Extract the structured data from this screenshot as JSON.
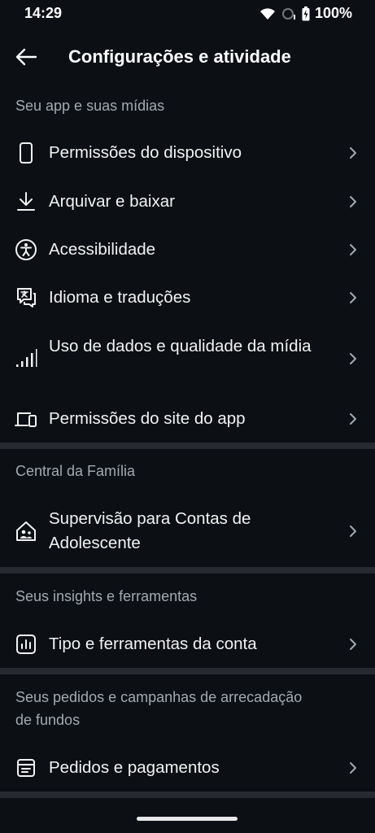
{
  "status_bar": {
    "time": "14:29",
    "battery": "100%"
  },
  "header": {
    "title": "Configurações e atividade"
  },
  "sections": [
    {
      "title": "Seu app e suas mídias",
      "items": [
        {
          "label": "Permissões do dispositivo",
          "icon": "phone-icon"
        },
        {
          "label": "Arquivar e baixar",
          "icon": "download-icon"
        },
        {
          "label": "Acessibilidade",
          "icon": "accessibility-icon"
        },
        {
          "label": "Idioma e traduções",
          "icon": "translate-icon"
        },
        {
          "label": "Uso de dados e qualidade da mídia",
          "icon": "signal-bars-icon"
        },
        {
          "label": "Permissões do site do app",
          "icon": "devices-icon"
        }
      ]
    },
    {
      "title": "Central da Família",
      "items": [
        {
          "label": "Supervisão para Contas de Adolescente",
          "icon": "family-home-icon"
        }
      ]
    },
    {
      "title": "Seus insights e ferramentas",
      "items": [
        {
          "label": "Tipo e ferramentas da conta",
          "icon": "chart-icon"
        }
      ]
    },
    {
      "title": "Seus pedidos e campanhas de arrecadação de fundos",
      "items": [
        {
          "label": "Pedidos e pagamentos",
          "icon": "receipt-icon"
        }
      ]
    }
  ]
}
